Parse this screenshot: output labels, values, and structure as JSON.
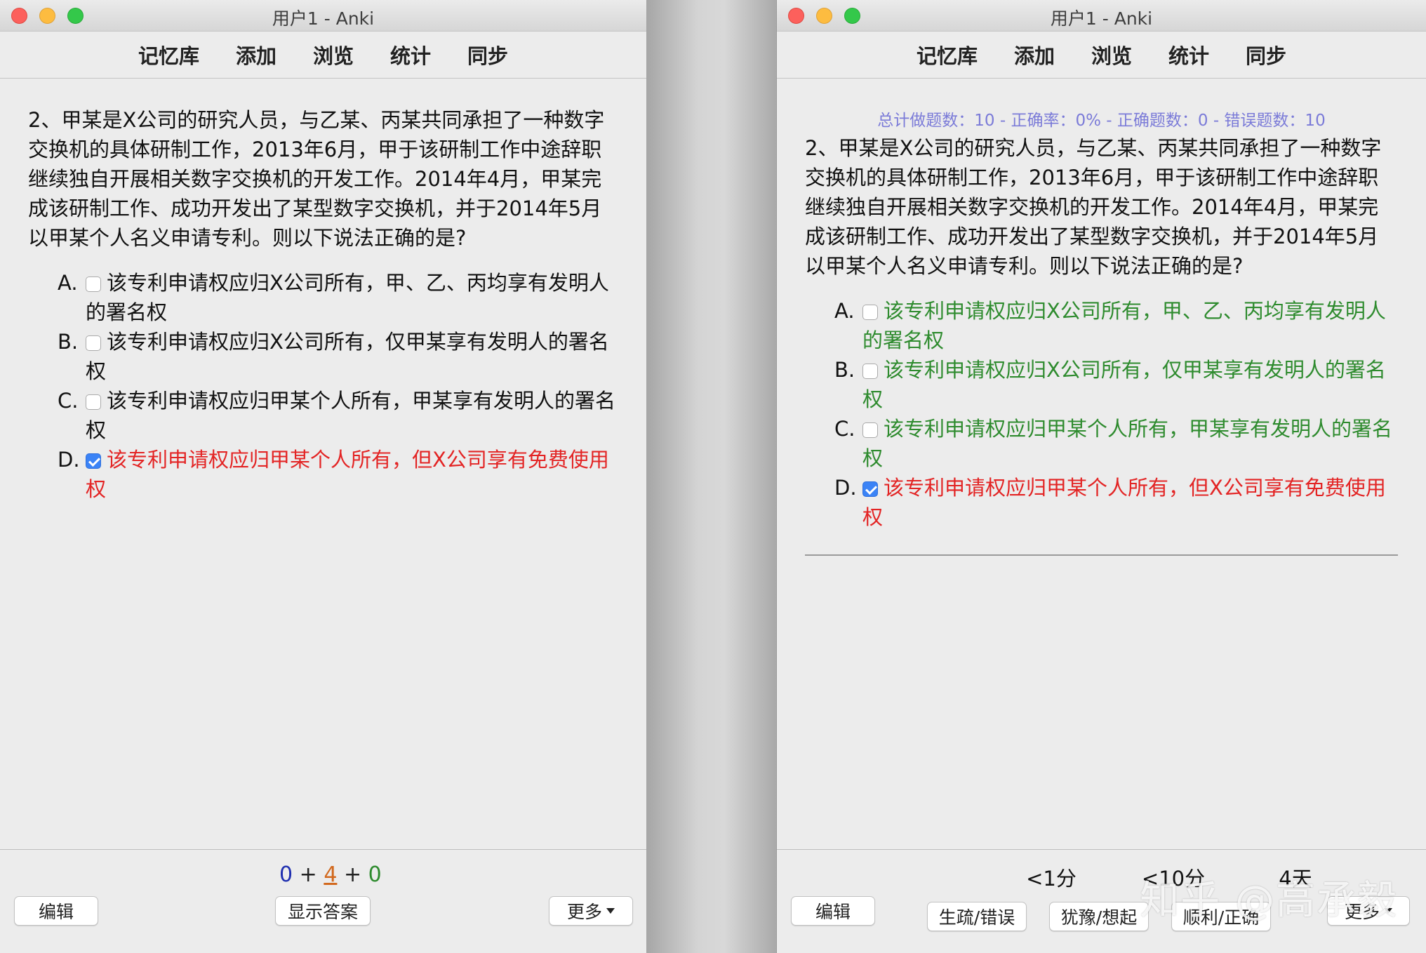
{
  "app_title": "用户1 - Anki",
  "toolbar": [
    "记忆库",
    "添加",
    "浏览",
    "统计",
    "同步"
  ],
  "stats_line": "总计做题数：10 - 正确率：0% - 正确题数：0 - 错误题数：10",
  "question": "2、甲某是X公司的研究人员，与乙某、丙某共同承担了一种数字交换机的具体研制工作，2013年6月，甲于该研制工作中途辞职继续独自开展相关数字交换机的开发工作。2014年4月，甲某完成该研制工作、成功开发出了某型数字交换机，并于2014年5月以甲某个人名义申请专利。则以下说法正确的是?",
  "options": [
    {
      "letter": "A.",
      "text": "该专利申请权应归X公司所有，甲、乙、丙均享有发明人的署名权",
      "checked": false
    },
    {
      "letter": "B.",
      "text": "该专利申请权应归X公司所有，仅甲某享有发明人的署名权",
      "checked": false
    },
    {
      "letter": "C.",
      "text": "该专利申请权应归甲某个人所有，甲某享有发明人的署名权",
      "checked": false
    },
    {
      "letter": "D.",
      "text": "该专利申请权应归甲某个人所有，但X公司享有免费使用权",
      "checked": true
    }
  ],
  "colors": {
    "correct": "#2e8b2e",
    "wrong": "#e32424",
    "stats": "#7b7bd8"
  },
  "left_bottom": {
    "edit": "编辑",
    "show_answer": "显示答案",
    "more": "更多",
    "counts": {
      "new": "0",
      "learn": "4",
      "review": "0",
      "plus": "+"
    }
  },
  "right_bottom": {
    "edit": "编辑",
    "more": "更多",
    "ease": [
      {
        "interval": "<1分",
        "label": "生疏/错误"
      },
      {
        "interval": "<10分",
        "label": "犹豫/想起"
      },
      {
        "interval": "4天",
        "label": "顺利/正确"
      }
    ]
  },
  "watermark": "知乎 @高承毅"
}
